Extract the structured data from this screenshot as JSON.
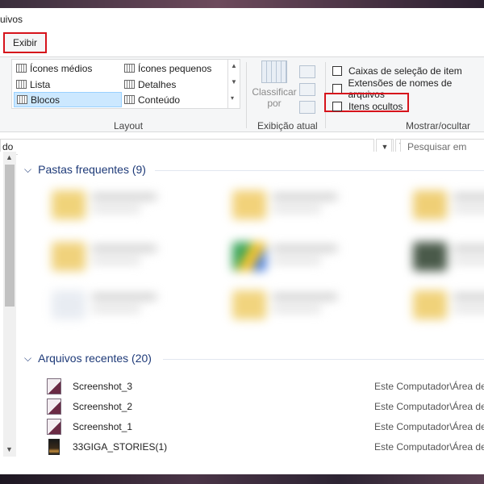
{
  "window": {
    "title": "uivos"
  },
  "tabs": {
    "exibir": "Exibir"
  },
  "ribbon": {
    "layout": {
      "label": "Layout",
      "items": [
        {
          "label": "Ícones médios",
          "selected": false
        },
        {
          "label": "Ícones pequenos",
          "selected": false
        },
        {
          "label": "Lista",
          "selected": false
        },
        {
          "label": "Detalhes",
          "selected": false
        },
        {
          "label": "Blocos",
          "selected": true
        },
        {
          "label": "Conteúdo",
          "selected": false
        }
      ]
    },
    "current_view": {
      "label": "Exibição atual",
      "sort_line1": "Classificar",
      "sort_line2": "por"
    },
    "show_hide": {
      "label": "Mostrar/ocultar",
      "checkboxes": [
        {
          "label": "Caixas de seleção de item",
          "checked": false
        },
        {
          "label": "Extensões de nomes de arquivos",
          "checked": false
        },
        {
          "label": "Itens ocultos",
          "checked": false
        }
      ]
    }
  },
  "address": {
    "value": "do",
    "search_placeholder": "Pesquisar em Aces"
  },
  "sections": {
    "frequent": "Pastas frequentes (9)",
    "recent": "Arquivos recentes (20)"
  },
  "recent_files": [
    {
      "name": "Screenshot_3",
      "path": "Este Computador\\Área de"
    },
    {
      "name": "Screenshot_2",
      "path": "Este Computador\\Área de"
    },
    {
      "name": "Screenshot_1",
      "path": "Este Computador\\Área de"
    },
    {
      "name": "33GIGA_STORIES(1)",
      "path": "Este Computador\\Área de"
    }
  ],
  "colors": {
    "highlight": "#d6131b",
    "selection": "#cce8ff",
    "section_header": "#1e3a78"
  }
}
